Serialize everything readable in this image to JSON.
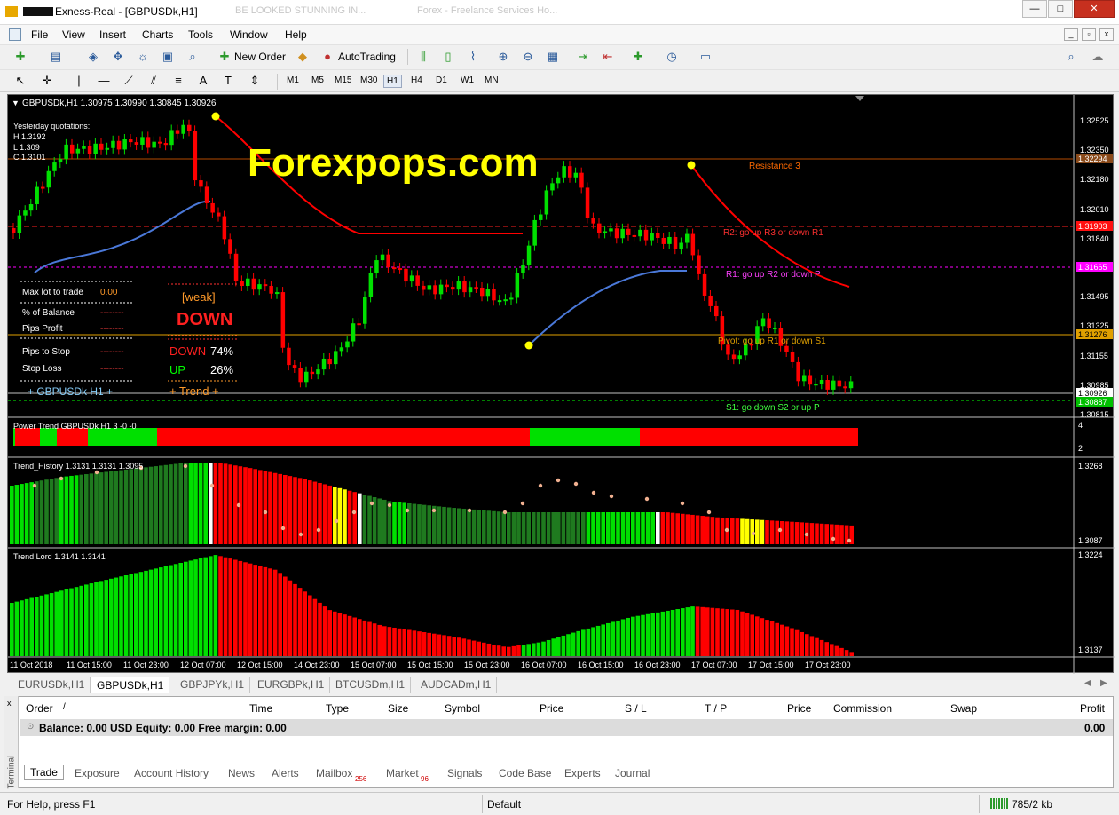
{
  "window": {
    "title": "Exness-Real - [GBPUSDk,H1]",
    "bg_tab_1": "Forex - Freelance Services Ho...",
    "bg_tab_2": "BE LOOKED STUNNING IN...",
    "minimize": "—",
    "maximize": "□",
    "close": "✕"
  },
  "menu": [
    "File",
    "View",
    "Insert",
    "Charts",
    "Tools",
    "Window",
    "Help"
  ],
  "toolbar": {
    "new_order": "New Order",
    "autotrading": "AutoTrading"
  },
  "timeframes": [
    "M1",
    "M5",
    "M15",
    "M30",
    "H1",
    "H4",
    "D1",
    "W1",
    "MN"
  ],
  "active_timeframe": "H1",
  "chart": {
    "symbol_header": "GBPUSDk,H1  1.30975 1.30990 1.30845 1.30926",
    "watermark": "Forexpops.com",
    "yesterday": {
      "title": "Yesterday quotations:",
      "h": "H 1.3192",
      "l": "L 1.309",
      "c": "C 1.3101"
    },
    "panel": {
      "max_lot_label": "Max lot to trade",
      "max_lot_value": "0.00",
      "pct_balance": "% of Balance",
      "pips_profit": "Pips Profit",
      "pips_to_stop": "Pips to Stop",
      "stop_loss": "Stop Loss",
      "dashes": "--------",
      "weak": "[weak]",
      "direction": "DOWN",
      "down_label": "DOWN",
      "down_pct": "74%",
      "up_label": "UP",
      "up_pct": "26%",
      "symbol_tag": "+ GBPUSDk  H1 +",
      "trend_tag": "+ Trend +"
    },
    "levels": {
      "resistance3": "Resistance 3",
      "r2": "R2: go up R3 or down R1",
      "r1": "R1: go up R2 or down P",
      "pivot": "Pivot: go up R1 or down S1",
      "s1": "S1: go down S2 or up P"
    },
    "price_axis": [
      "1.32525",
      "1.32350",
      "1.32180",
      "1.32010",
      "1.31840",
      "1.31495",
      "1.31325",
      "1.31155",
      "1.30985",
      "1.30815"
    ],
    "price_tags": {
      "r3": "1.32294",
      "r2": "1.31903",
      "r1": "1.31665",
      "pivot": "1.31276",
      "current": "1.30926",
      "s1": "1.30887"
    },
    "subwindows": {
      "power_trend": {
        "title": "Power Trend GBPUSDk H1 3 -0 -0",
        "axis_top": "4",
        "axis_bottom": "2"
      },
      "trend_history": {
        "title": "Trend_History 1.3131 1.3131 1.3095",
        "axis_top": "1.3268",
        "axis_bottom": "1.3087"
      },
      "trend_lord": {
        "title": "Trend Lord 1.3141 1.3141",
        "axis_top": "1.3224",
        "axis_bottom": "1.3137"
      }
    },
    "time_axis": [
      "11 Oct 2018",
      "11 Oct 15:00",
      "11 Oct 23:00",
      "12 Oct 07:00",
      "12 Oct 15:00",
      "14 Oct 23:00",
      "15 Oct 07:00",
      "15 Oct 15:00",
      "15 Oct 23:00",
      "16 Oct 07:00",
      "16 Oct 15:00",
      "16 Oct 23:00",
      "17 Oct 07:00",
      "17 Oct 15:00",
      "17 Oct 23:00"
    ],
    "colors": {
      "bull": "#00e000",
      "bear": "#ff0000",
      "dark_bull": "#1f7a1f",
      "yellow": "#ffff00",
      "ma": "#4a78d8",
      "watermark": "#ffff00"
    }
  },
  "symbol_tabs": [
    "EURUSDk,H1",
    "GBPUSDk,H1",
    "GBPJPYk,H1",
    "EURGBPk,H1",
    "BTCUSDm,H1",
    "AUDCADm,H1"
  ],
  "active_symbol_tab": "GBPUSDk,H1",
  "terminal": {
    "side_label": "Terminal",
    "columns": [
      "Order",
      "/",
      "Time",
      "Type",
      "Size",
      "Symbol",
      "Price",
      "S / L",
      "T / P",
      "Price",
      "Commission",
      "Swap",
      "Profit"
    ],
    "balance_row": "Balance: 0.00 USD  Equity: 0.00  Free margin: 0.00",
    "balance_profit": "0.00",
    "tabs": [
      "Trade",
      "Exposure",
      "Account History",
      "News",
      "Alerts",
      "Mailbox",
      "Market",
      "Signals",
      "Code Base",
      "Experts",
      "Journal"
    ],
    "mailbox_badge": "256",
    "market_badge": "96"
  },
  "status": {
    "help": "For Help, press F1",
    "profile": "Default",
    "traffic": "785/2 kb"
  }
}
